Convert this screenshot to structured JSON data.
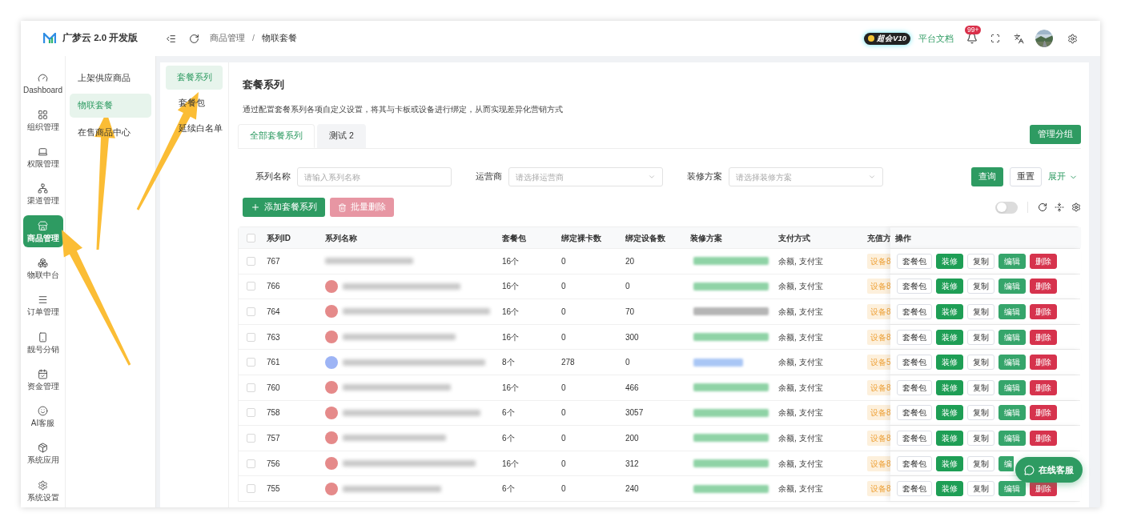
{
  "app": {
    "name": "广梦云 2.0 开发版"
  },
  "header": {
    "breadcrumb": [
      "商品管理",
      "物联套餐"
    ],
    "separator": "/",
    "vip_badge": "超会V10",
    "docs_link": "平台文档",
    "notifications": "99+"
  },
  "rail": [
    {
      "label": "Dashboard",
      "selected": false
    },
    {
      "label": "组织管理",
      "selected": false
    },
    {
      "label": "权限管理",
      "selected": false
    },
    {
      "label": "渠道管理",
      "selected": false
    },
    {
      "label": "商品管理",
      "selected": true
    },
    {
      "label": "物联中台",
      "selected": false
    },
    {
      "label": "订单管理",
      "selected": false
    },
    {
      "label": "靓号分销",
      "selected": false
    },
    {
      "label": "资金管理",
      "selected": false
    },
    {
      "label": "AI客服",
      "selected": false
    },
    {
      "label": "系统应用",
      "selected": false
    },
    {
      "label": "系统设置",
      "selected": false
    }
  ],
  "submenu": [
    {
      "label": "上架供应商品",
      "selected": false
    },
    {
      "label": "物联套餐",
      "selected": true
    },
    {
      "label": "在售商品中心",
      "selected": false
    }
  ],
  "inner_menu": [
    {
      "label": "套餐系列",
      "selected": true
    },
    {
      "label": "套餐包",
      "selected": false
    },
    {
      "label": "延续白名单",
      "selected": false
    }
  ],
  "page": {
    "title": "套餐系列",
    "description": "通过配置套餐系列各项自定义设置，将其与卡板或设备进行绑定，从而实现差异化营销方式"
  },
  "tabs": [
    {
      "label": "全部套餐系列",
      "selected": true
    },
    {
      "label": "测试 2",
      "selected": false
    }
  ],
  "manage_button": "管理分组",
  "filters": [
    {
      "label": "系列名称",
      "kind": "input",
      "placeholder": "请输入系列名称"
    },
    {
      "label": "运营商",
      "kind": "select",
      "placeholder": "请选择运营商"
    },
    {
      "label": "装修方案",
      "kind": "select",
      "placeholder": "请选择装修方案"
    }
  ],
  "filter_buttons": {
    "search": "查询",
    "reset": "重置",
    "expand": "展开"
  },
  "toolbar": {
    "add": "添加套餐系列",
    "batch_delete": "批量删除",
    "toggle": {
      "on": false
    }
  },
  "table": {
    "select_all": {
      "checked": false
    },
    "columns": [
      "系列ID",
      "系列名称",
      "套餐包",
      "绑定裸卡数",
      "绑定设备数",
      "装修方案",
      "支付方式",
      "充值方",
      "操作"
    ],
    "rows": [
      {
        "checked": false,
        "id": "767",
        "scheme": {
          "color": "#8fd3a6"
        },
        "packages": "16个",
        "bare_cards": "0",
        "devices": "20",
        "payment": "余额, 支付宝",
        "charge": "设备8",
        "actions": [
          {
            "label": "套餐包",
            "kind": "default"
          },
          {
            "label": "装修",
            "kind": "success"
          },
          {
            "label": "复制",
            "kind": "default"
          },
          {
            "label": "编辑",
            "kind": "primary"
          },
          {
            "label": "删除",
            "kind": "danger"
          }
        ]
      },
      {
        "checked": false,
        "id": "766",
        "name": {
          "color": "#e58a8a"
        },
        "scheme": {
          "color": "#8fd3a6"
        },
        "packages": "16个",
        "bare_cards": "0",
        "devices": "0",
        "payment": "余额, 支付宝",
        "charge": "设备8",
        "actions": [
          {
            "label": "套餐包",
            "kind": "default"
          },
          {
            "label": "装修",
            "kind": "success"
          },
          {
            "label": "复制",
            "kind": "default"
          },
          {
            "label": "编辑",
            "kind": "primary"
          },
          {
            "label": "删除",
            "kind": "danger"
          }
        ]
      },
      {
        "checked": false,
        "id": "764",
        "name": {
          "color": "#e58a8a"
        },
        "scheme": {
          "color": "#b5b5b5"
        },
        "packages": "16个",
        "bare_cards": "0",
        "devices": "70",
        "payment": "余额, 支付宝",
        "charge": "设备8",
        "actions": [
          {
            "label": "套餐包",
            "kind": "default"
          },
          {
            "label": "装修",
            "kind": "success"
          },
          {
            "label": "复制",
            "kind": "default"
          },
          {
            "label": "编辑",
            "kind": "primary"
          },
          {
            "label": "删除",
            "kind": "danger"
          }
        ]
      },
      {
        "checked": false,
        "id": "763",
        "name": {
          "color": "#e58a8a"
        },
        "scheme": {
          "color": "#8fd3a6"
        },
        "packages": "16个",
        "bare_cards": "0",
        "devices": "300",
        "payment": "余额, 支付宝",
        "charge": "设备8",
        "actions": [
          {
            "label": "套餐包",
            "kind": "default"
          },
          {
            "label": "装修",
            "kind": "success"
          },
          {
            "label": "复制",
            "kind": "default"
          },
          {
            "label": "编辑",
            "kind": "primary"
          },
          {
            "label": "删除",
            "kind": "danger"
          }
        ]
      },
      {
        "checked": false,
        "id": "761",
        "name": {
          "color": "#9db4f5"
        },
        "scheme": {
          "color": "#a9c6f5"
        },
        "packages": "8个",
        "bare_cards": "278",
        "devices": "0",
        "payment": "余额, 支付宝",
        "charge": "设备5",
        "actions": [
          {
            "label": "套餐包",
            "kind": "default"
          },
          {
            "label": "装修",
            "kind": "success"
          },
          {
            "label": "复制",
            "kind": "default"
          },
          {
            "label": "编辑",
            "kind": "primary"
          },
          {
            "label": "删除",
            "kind": "danger"
          }
        ]
      },
      {
        "checked": false,
        "id": "760",
        "name": {
          "color": "#e58a8a"
        },
        "scheme": {
          "color": "#8fd3a6"
        },
        "packages": "16个",
        "bare_cards": "0",
        "devices": "466",
        "payment": "余额, 支付宝",
        "charge": "设备8",
        "actions": [
          {
            "label": "套餐包",
            "kind": "default"
          },
          {
            "label": "装修",
            "kind": "success"
          },
          {
            "label": "复制",
            "kind": "default"
          },
          {
            "label": "编辑",
            "kind": "primary"
          },
          {
            "label": "删除",
            "kind": "danger"
          }
        ]
      },
      {
        "checked": false,
        "id": "758",
        "name": {
          "color": "#e58a8a"
        },
        "scheme": {
          "color": "#8fd3a6"
        },
        "packages": "6个",
        "bare_cards": "0",
        "devices": "3057",
        "payment": "余额, 支付宝",
        "charge": "设备8",
        "actions": [
          {
            "label": "套餐包",
            "kind": "default"
          },
          {
            "label": "装修",
            "kind": "success"
          },
          {
            "label": "复制",
            "kind": "default"
          },
          {
            "label": "编辑",
            "kind": "primary"
          },
          {
            "label": "删除",
            "kind": "danger"
          }
        ]
      },
      {
        "checked": false,
        "id": "757",
        "name": {
          "color": "#e58a8a"
        },
        "scheme": {
          "color": "#8fd3a6"
        },
        "packages": "6个",
        "bare_cards": "0",
        "devices": "200",
        "payment": "余额, 支付宝",
        "charge": "设备8",
        "actions": [
          {
            "label": "套餐包",
            "kind": "default"
          },
          {
            "label": "装修",
            "kind": "success"
          },
          {
            "label": "复制",
            "kind": "default"
          },
          {
            "label": "编辑",
            "kind": "primary"
          },
          {
            "label": "删除",
            "kind": "danger"
          }
        ]
      },
      {
        "checked": false,
        "id": "756",
        "name": {
          "color": "#e58a8a"
        },
        "scheme": {
          "color": "#8fd3a6"
        },
        "packages": "16个",
        "bare_cards": "0",
        "devices": "312",
        "payment": "余额, 支付宝",
        "charge": "设备8",
        "actions": [
          {
            "label": "套餐包",
            "kind": "default"
          },
          {
            "label": "装修",
            "kind": "success"
          },
          {
            "label": "复制",
            "kind": "default"
          },
          {
            "label": "编",
            "kind": "primary"
          }
        ]
      },
      {
        "checked": false,
        "id": "755",
        "name": {
          "color": "#e58a8a"
        },
        "scheme": {
          "color": "#8fd3a6"
        },
        "packages": "6个",
        "bare_cards": "0",
        "devices": "240",
        "payment": "余额, 支付宝",
        "charge": "设备8",
        "actions": [
          {
            "label": "套餐包",
            "kind": "default"
          },
          {
            "label": "装修",
            "kind": "success"
          },
          {
            "label": "复制",
            "kind": "default"
          },
          {
            "label": "编辑",
            "kind": "primary"
          },
          {
            "label": "删除",
            "kind": "danger"
          }
        ]
      }
    ]
  },
  "chat_button": "在线客服"
}
